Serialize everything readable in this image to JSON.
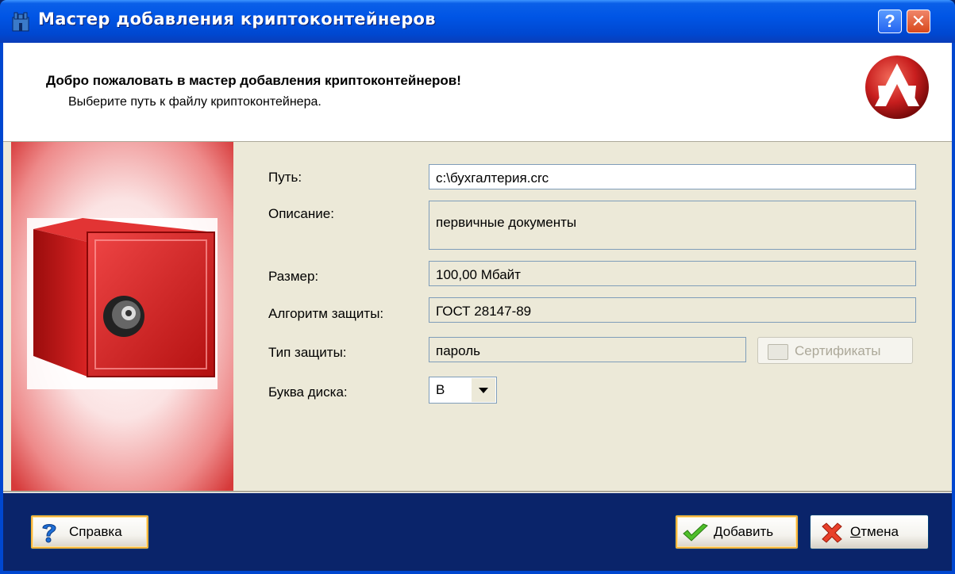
{
  "window": {
    "title": "Мастер добавления криптоконтейнеров"
  },
  "header": {
    "title": "Добро пожаловать в мастер добавления криптоконтейнеров!",
    "subtitle": "Выберите путь к файлу криптоконтейнера."
  },
  "form": {
    "path_label": "Путь:",
    "path_value": "c:\\бухгалтерия.crc",
    "description_label": "Описание:",
    "description_value": "первичные документы",
    "size_label": "Размер:",
    "size_value": "100,00 Мбайт",
    "algorithm_label": "Алгоритм защиты:",
    "algorithm_value": "ГОСТ 28147-89",
    "protection_label": "Тип защиты:",
    "protection_value": "пароль",
    "certificates_button": "Сертификаты",
    "drive_label": "Буква диска:",
    "drive_value": "B"
  },
  "footer": {
    "help_button": "Справка",
    "add_button_prefix": "Д",
    "add_button_rest": "обавить",
    "cancel_button_prefix": "О",
    "cancel_button_rest": "тмена"
  },
  "colors": {
    "titlebar": "#0055e5",
    "safe_red": "#d41a1a",
    "face": "#ece9d8"
  }
}
